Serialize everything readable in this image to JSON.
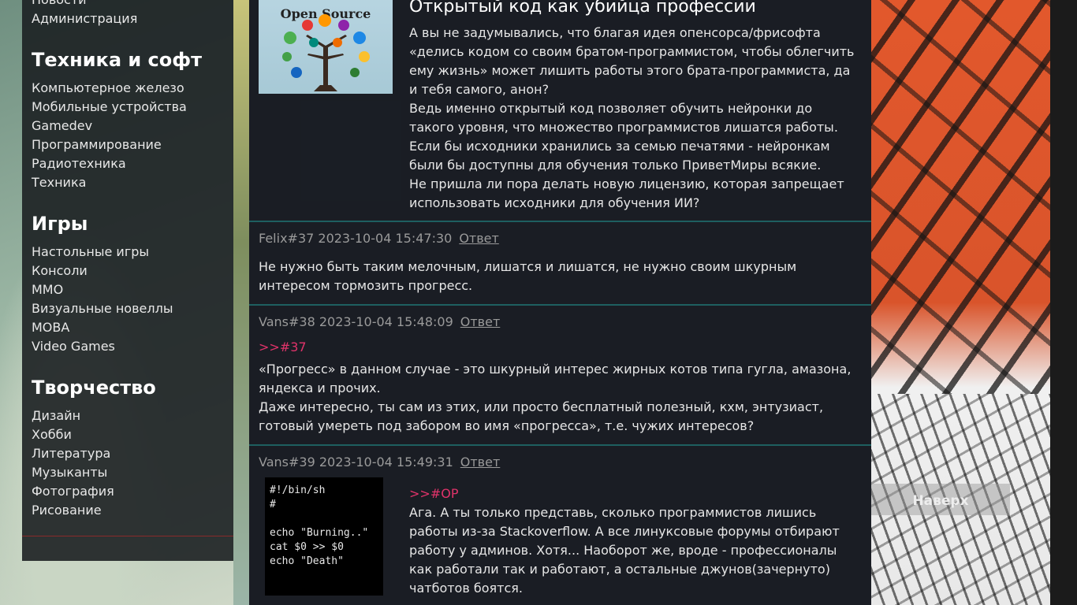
{
  "sidebar": {
    "top_items": [
      "Новости",
      "Администрация"
    ],
    "sections": [
      {
        "title": "Техника и софт",
        "items": [
          "Компьютерное железо",
          "Мобильные устройства",
          "Gamedev",
          "Программирование",
          "Радиотехника",
          "Техника"
        ]
      },
      {
        "title": "Игры",
        "items": [
          "Настольные игры",
          "Консоли",
          "MMO",
          "Визуальные новеллы",
          "MOBA",
          "Video Games"
        ]
      },
      {
        "title": "Творчество",
        "items": [
          "Дизайн",
          "Хобби",
          "Литература",
          "Музыканты",
          "Фотография",
          "Рисование"
        ]
      }
    ]
  },
  "article": {
    "image_caption": "Open Source",
    "title": "Открытый код как убийца профессии",
    "paragraphs": [
      "А вы не задумывались, что благая идея опенсорса/фрисофта «делись кодом со своим братом-программистом, чтобы облегчить ему жизнь» может лишить работы этого брата-программиста, да и тебя самого, анон?",
      "Ведь именно открытый код позволяет обучить нейронки до такого уровня, что множество программистов лишатся работы. Если бы исходники хранились за семью печатями - нейронкам были бы доступны для обучения только ПриветМиры всякие.",
      "Не пришла ли пора делать новую лицензию, которая запрещает использовать исходники для обучения ИИ?"
    ]
  },
  "posts": [
    {
      "meta": "Felix#37 2023-10-04 15:47:30",
      "reply_label": "Ответ",
      "quote": "",
      "text": "Не нужно быть таким мелочным, лишатся и лишатся, не нужно своим шкурным интересом тормозить прогресс."
    },
    {
      "meta": "Vans#38 2023-10-04 15:48:09",
      "reply_label": "Ответ",
      "quote": ">>#37",
      "text": "«Прогресс» в данном случае - это шкурный интерес жирных котов типа гугла, амазона, яндекса и прочих.",
      "text2": "Даже интересно, ты сам из этих, или просто бесплатный полезный, кхм, энтузиаст, готовый умереть под забором во имя «прогресса», т.е. чужих интересов?"
    },
    {
      "meta": "Vans#39 2023-10-04 15:49:31",
      "reply_label": "Ответ",
      "quote": ">>#OP",
      "code": "#!/bin/sh\n#\n\necho \"Burning..\"\ncat $0 >> $0\necho \"Death\"",
      "text": "Ага. А ты только представь, сколько программистов лишись работы из-за Stackoverflow. А все линуксовые форумы отбирают работу у админов. Хотя... Наоборот же, вроде - профессионалы как работали так и работают, а остальные джунов(зачернуто) чатботов боятся."
    }
  ],
  "to_top_label": "Наверх"
}
